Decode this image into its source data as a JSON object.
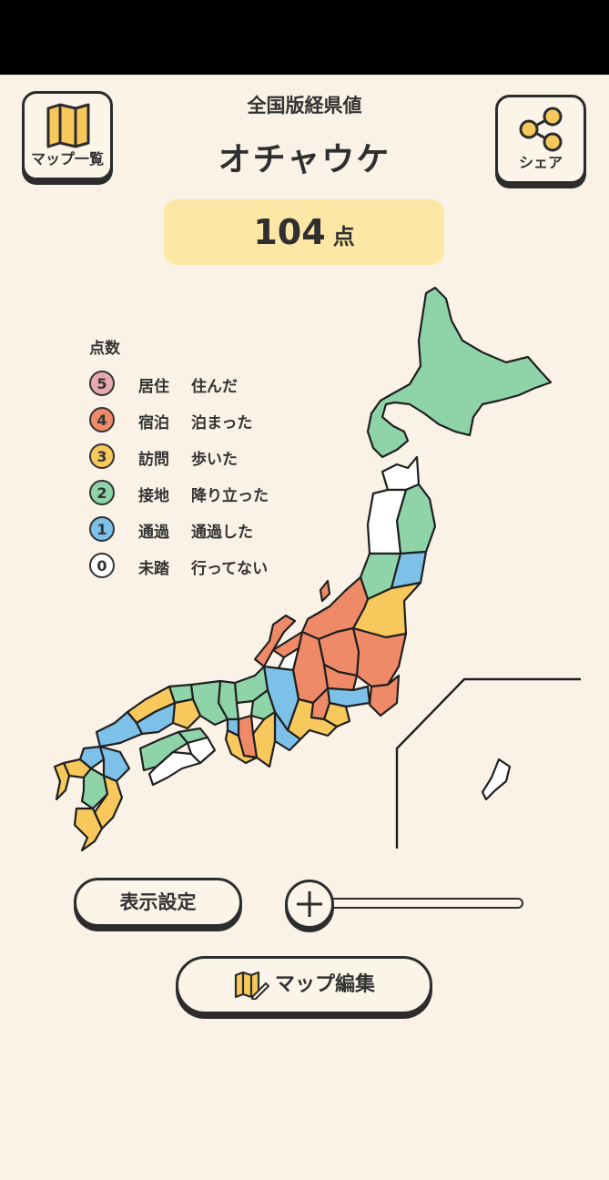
{
  "header": {
    "subtitle": "全国版経県値",
    "title": "オチャウケ",
    "map_list_label": "マップ一覧",
    "share_label": "シェア"
  },
  "score": {
    "value": "104",
    "unit": "点"
  },
  "legend": {
    "title": "点数",
    "items": [
      {
        "score": "5",
        "kind": "居住",
        "desc": "住んだ",
        "color": "#e8a9b0"
      },
      {
        "score": "4",
        "kind": "宿泊",
        "desc": "泊まった",
        "color": "#ef8a69"
      },
      {
        "score": "3",
        "kind": "訪問",
        "desc": "歩いた",
        "color": "#f7c85c"
      },
      {
        "score": "2",
        "kind": "接地",
        "desc": "降り立った",
        "color": "#8fd4a9"
      },
      {
        "score": "1",
        "kind": "通過",
        "desc": "通過した",
        "color": "#7dc0e8"
      },
      {
        "score": "0",
        "kind": "未踏",
        "desc": "行ってない",
        "color": "#ffffff"
      }
    ]
  },
  "controls": {
    "display_settings_label": "表示設定",
    "edit_map_label": "マップ編集",
    "zoom_level": 0
  }
}
